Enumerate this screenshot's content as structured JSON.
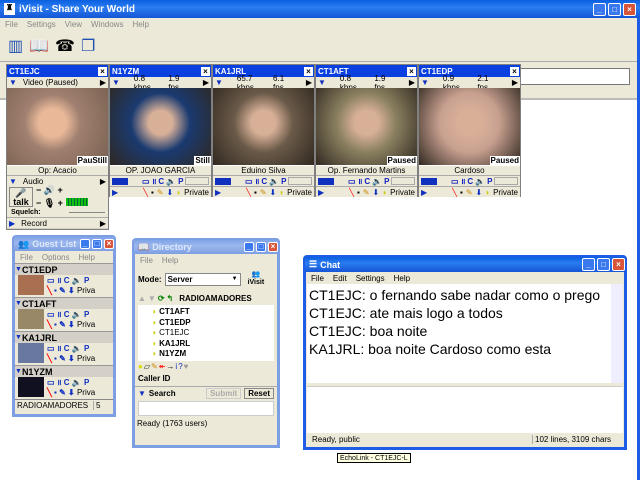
{
  "app": {
    "title": "iVisit - Share Your World",
    "menu": [
      "File",
      "Settings",
      "View",
      "Windows",
      "Help"
    ],
    "toolbar": [
      "contacts-icon",
      "directory-icon",
      "phone-icon",
      "windows-icon"
    ]
  },
  "panels": [
    {
      "call": "CT1EJC",
      "stats": "Video (Paused)",
      "label": "PauStill",
      "name": "Op: Acacio",
      "bg": "#b89070"
    },
    {
      "call": "N1YZM",
      "stats1": "0.8 kbps",
      "stats2": "1.9 fps",
      "label": "Still",
      "name": "OP. JOAO GARCIA",
      "bg": "#1a3a70"
    },
    {
      "call": "KA1JRL",
      "stats1": "65.7 kbps",
      "stats2": "6.1 fps",
      "label": "",
      "name": "Eduino Silva",
      "bg": "#6a5a48"
    },
    {
      "call": "CT1AFT",
      "stats1": "0.8 kbps",
      "stats2": "1.9 fps",
      "label": "Paused",
      "name": "Op. Fernando Martins",
      "bg": "#8a8060"
    },
    {
      "call": "CT1EDP",
      "stats1": "0.9 kbps",
      "stats2": "2.1 fps",
      "label": "Paused",
      "name": "Cardoso",
      "bg": "#c8a090"
    }
  ],
  "controls": {
    "private": "Private",
    "c": "C",
    "p": "P"
  },
  "audio": {
    "label": "Audio",
    "talk": "talk",
    "squelch": "Squelch:",
    "record": "Record"
  },
  "guestlist": {
    "title": "Guest List",
    "menu": [
      "File",
      "Options",
      "Help"
    ],
    "guests": [
      "CT1EDP",
      "CT1AFT",
      "KA1JRL",
      "N1YZM"
    ],
    "room": "RADIOAMADORES",
    "count": "5",
    "private": "Priva"
  },
  "directory": {
    "title": "Directory",
    "menu": [
      "File",
      "Help"
    ],
    "mode_label": "Mode:",
    "mode_value": "Server",
    "logo": "iVisit",
    "room": "RADIOAMADORES",
    "users": [
      "CT1AFT",
      "CT1EDP",
      "CT1EJC",
      "KA1JRL",
      "N1YZM"
    ],
    "caller_id": "Caller ID",
    "search": "Search",
    "submit": "Submit",
    "reset": "Reset",
    "status": "Ready  (1763 users)"
  },
  "chat": {
    "title": "Chat",
    "menu": [
      "File",
      "Edit",
      "Settings",
      "Help"
    ],
    "messages": [
      {
        "from": "CT1EJC",
        "text": ": o fernando sabe nadar como o prego"
      },
      {
        "from": "CT1EJC",
        "text": ": ate mais logo a todos"
      },
      {
        "from": "CT1EJC",
        "text": ": boa noite"
      },
      {
        "from": "KA1JRL",
        "text": ": boa noite Cardoso como esta"
      }
    ],
    "status": "Ready, public",
    "stats": "102 lines, 3109 chars"
  },
  "tooltip": "EchoLink - CT1EJC-L"
}
